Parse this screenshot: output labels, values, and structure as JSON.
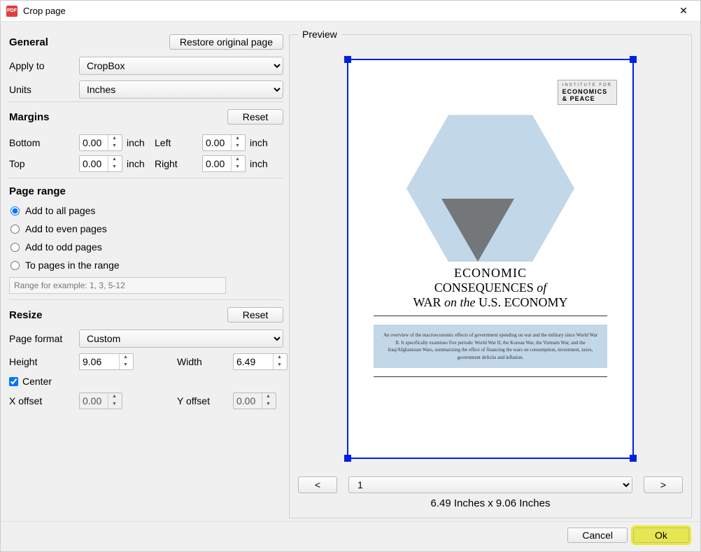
{
  "window": {
    "title": "Crop page"
  },
  "general": {
    "heading": "General",
    "restore_btn": "Restore original page",
    "apply_to_label": "Apply to",
    "apply_to_value": "CropBox",
    "units_label": "Units",
    "units_value": "Inches"
  },
  "margins": {
    "heading": "Margins",
    "reset_btn": "Reset",
    "bottom_label": "Bottom",
    "bottom_value": "0.00",
    "top_label": "Top",
    "top_value": "0.00",
    "left_label": "Left",
    "left_value": "0.00",
    "right_label": "Right",
    "right_value": "0.00",
    "unit": "inch"
  },
  "page_range": {
    "heading": "Page range",
    "opt_all": "Add to all pages",
    "opt_even": "Add to even pages",
    "opt_odd": "Add to odd pages",
    "opt_range": "To pages in the range",
    "placeholder": "Range for example: 1, 3, 5-12",
    "selected": "all"
  },
  "resize": {
    "heading": "Resize",
    "reset_btn": "Reset",
    "page_format_label": "Page format",
    "page_format_value": "Custom",
    "height_label": "Height",
    "height_value": "9.06",
    "width_label": "Width",
    "width_value": "6.49",
    "center_label": "Center",
    "center_checked": true,
    "xoffset_label": "X offset",
    "xoffset_value": "0.00",
    "yoffset_label": "Y offset",
    "yoffset_value": "0.00"
  },
  "preview": {
    "heading": "Preview",
    "prev_btn": "<",
    "next_btn": ">",
    "page_value": "1",
    "dimensions": "6.49 Inches x 9.06 Inches",
    "logo_l1": "INSTITUTE FOR",
    "logo_l2": "ECONOMICS",
    "logo_l3": "& PEACE",
    "doc_t1": "ECONOMIC",
    "doc_t2a": "CONSEQUENCES ",
    "doc_t2b": "of",
    "doc_t3a": "WAR ",
    "doc_t3b": "on the",
    "doc_t3c": " U.S. ECONOMY",
    "abstract": "An overview of the macroeconomic effects of government spending on war and the military since World War II. It specifically examines five periods: World War II, the Korean War, the Vietnam War, and the Iraq/Afghanistan Wars, summarizing the effect of financing the wars on consumption, investment, taxes, government deficits and inflation."
  },
  "footer": {
    "cancel": "Cancel",
    "ok": "Ok"
  }
}
